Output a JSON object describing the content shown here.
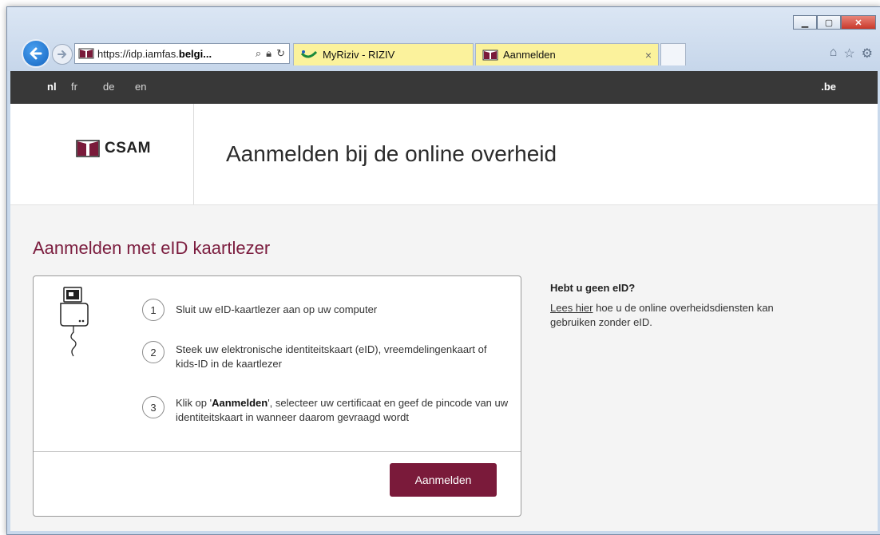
{
  "browser": {
    "address_url": "https://idp.iamfas.",
    "address_url_bold": "belgi...",
    "tabs": [
      {
        "label": "MyRiziv - RIZIV"
      },
      {
        "label": "Aanmelden",
        "close": "×"
      }
    ]
  },
  "langbar": {
    "languages": [
      "nl",
      "fr",
      "de",
      "en"
    ],
    "active": "nl",
    "site_mark": ".be"
  },
  "header": {
    "logo_text": "CSAM",
    "title": "Aanmelden bij de online overheid"
  },
  "main": {
    "title": "Aanmelden met eID kaartlezer",
    "steps": [
      {
        "number": "1",
        "text": "Sluit uw eID-kaartlezer aan op uw computer"
      },
      {
        "number": "2",
        "text": "Steek uw elektronische identiteitskaart (eID), vreemdelingenkaart of kids-ID in de kaartlezer"
      },
      {
        "number": "3",
        "text_before": "Klik op '",
        "text_bold": "Aanmelden",
        "text_after": "', selecteer uw certificaat en geef de pincode van uw identiteitskaart in wanneer daarom gevraagd wordt"
      }
    ],
    "button_label": "Aanmelden"
  },
  "sidebar": {
    "heading": "Hebt u geen eID?",
    "link_text": "Lees hier",
    "text": " hoe u de online overheidsdiensten kan gebruiken zonder eID."
  },
  "colors": {
    "brand": "#7a1a3a",
    "langbar": "#383838",
    "tab_highlight": "#fbf29c"
  },
  "icons": [
    "back-arrow-icon",
    "forward-arrow-icon",
    "search-icon",
    "lock-icon",
    "refresh-icon",
    "home-icon",
    "star-icon",
    "gear-icon",
    "card-reader-icon",
    "csam-logo-icon"
  ]
}
